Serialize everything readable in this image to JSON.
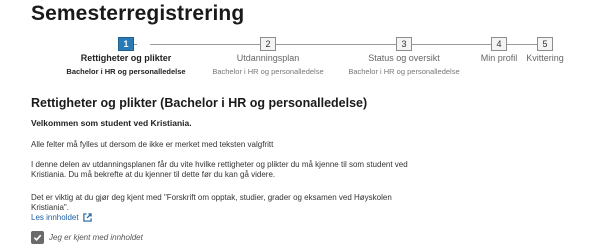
{
  "page": {
    "title": "Semesterregistrering"
  },
  "stepper": {
    "steps": [
      {
        "number": "1",
        "label": "Rettigheter og plikter",
        "sub": "Bachelor i HR og personalledelse",
        "active": true
      },
      {
        "number": "2",
        "label": "Utdanningsplan",
        "sub": "Bachelor i HR og personalledelse",
        "active": false
      },
      {
        "number": "3",
        "label": "Status og oversikt",
        "sub": "Bachelor i HR og personalledelse",
        "active": false
      },
      {
        "number": "4",
        "label": "Min profil",
        "sub": "",
        "active": false
      },
      {
        "number": "5",
        "label": "Kvittering",
        "sub": "",
        "active": false
      }
    ]
  },
  "content": {
    "section_title": "Rettigheter og plikter (Bachelor i HR og personalledelse)",
    "welcome": "Velkommen som student ved Kristiania.",
    "para1": "Alle felter må fylles ut dersom de ikke er merket med teksten valgfritt",
    "para2": "I denne delen av utdanningsplanen får du vite hvilke rettigheter og plikter du må kjenne til som student ved Kristiania. Du må bekrefte at du kjenner til dette før du kan gå videre.",
    "para3": "Det er viktig at du gjør deg kjent med \"Forskrift om opptak, studier, grader og eksamen ved Høyskolen Kristiania\".",
    "read_link": "Les innholdet",
    "consent_label": "Jeg er kjent med innholdet",
    "consent_checked": true
  },
  "colors": {
    "accent": "#2a7ab8",
    "link": "#1d5fa3",
    "checkbox": "#6a6a6a"
  },
  "icons": {
    "external_link": "external-link-icon",
    "check": "check-icon"
  }
}
